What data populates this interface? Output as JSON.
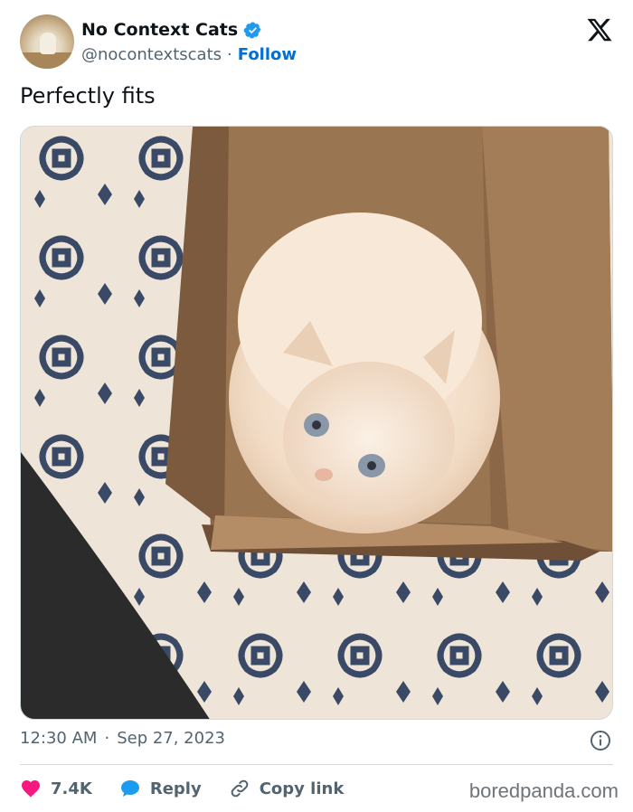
{
  "account": {
    "display_name": "No Context Cats",
    "handle": "@nocontextscats",
    "separator": "·",
    "follow_label": "Follow",
    "verified": true
  },
  "tweet": {
    "text": "Perfectly fits",
    "time": "12:30 AM",
    "dot": "·",
    "date": "Sep 27, 2023"
  },
  "actions": {
    "likes": "7.4K",
    "reply_label": "Reply",
    "copy_link_label": "Copy link"
  },
  "watermark": "boredpanda.com",
  "colors": {
    "accent": "#006fd6",
    "verified": "#1d9bf0",
    "like": "#f91880",
    "muted": "#536471",
    "text": "#0f1419"
  },
  "icons": {
    "brand": "x-logo-icon",
    "verified": "verified-badge-icon",
    "info": "info-icon",
    "like": "heart-icon",
    "reply": "speech-bubble-icon",
    "copy_link": "link-icon"
  }
}
